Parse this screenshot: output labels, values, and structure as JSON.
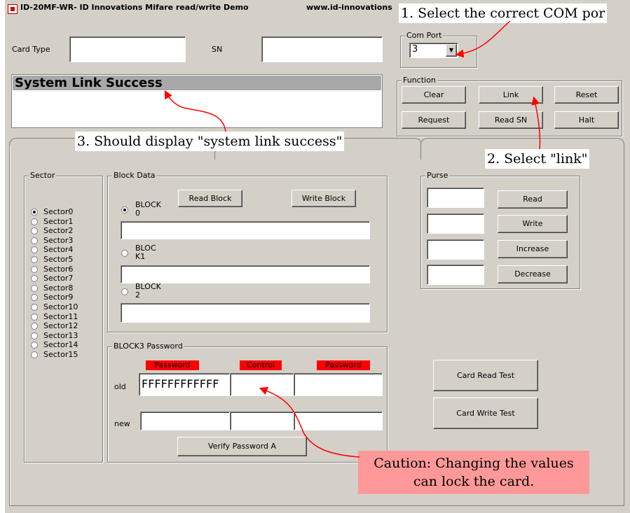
{
  "window": {
    "title": "ID-20MF-WR- ID Innovations Mifare read/write Demo",
    "url": "www.id-innovations"
  },
  "header": {
    "card_type_label": "Card Type",
    "card_type_value": "",
    "sn_label": "SN",
    "sn_value": ""
  },
  "com_port": {
    "label": "Com Port",
    "value": "3"
  },
  "status": {
    "message": "System Link Success"
  },
  "function_group": {
    "label": "Function",
    "buttons": [
      "Clear",
      "Link",
      "Reset",
      "Request",
      "Read SN",
      "Halt"
    ]
  },
  "sector_group": {
    "label": "Sector",
    "selected": "Sector0",
    "items": [
      "Sector0",
      "Sector1",
      "Sector2",
      "Sector3",
      "Sector4",
      "Sector5",
      "Sector6",
      "Sector7",
      "Sector8",
      "Sector9",
      "Sector10",
      "Sector11",
      "Sector12",
      "Sector13",
      "Sector14",
      "Sector15"
    ]
  },
  "block_data": {
    "label": "Block Data",
    "read_label": "Read Block",
    "write_label": "Write Block",
    "blocks": [
      {
        "line1": "BLOCK",
        "line2": "0",
        "value": ""
      },
      {
        "line1": "BLOC",
        "line2": "K1",
        "value": ""
      },
      {
        "line1": "BLOCK",
        "line2": "2",
        "value": ""
      }
    ]
  },
  "password_group": {
    "label": "BLOCK3 Password",
    "tags": [
      "Password",
      "Control",
      "Password"
    ],
    "old_label": "old",
    "new_label": "new",
    "old_values": [
      "FFFFFFFFFFFF",
      "",
      ""
    ],
    "new_values": [
      "",
      "",
      ""
    ],
    "verify_label": "Verify Password A"
  },
  "purse": {
    "label": "Purse",
    "buttons": [
      "Read",
      "Write",
      "Increase",
      "Decrease"
    ],
    "values": [
      "",
      "",
      "",
      ""
    ]
  },
  "tests": {
    "read_label": "Card Read Test",
    "write_label": "Card Write Test"
  },
  "annotations": {
    "step1": "1. Select the correct COM por",
    "step2": "2. Select \"link\"",
    "step3": "3. Should display \"system link success\"",
    "caution_line1": "Caution: Changing the values",
    "caution_line2": "can lock the card."
  },
  "colors": {
    "window_bg": "#d4d0c8",
    "arrow": "#ff0000",
    "caution_bg": "#ff9999",
    "tag_red": "#ff0000"
  }
}
